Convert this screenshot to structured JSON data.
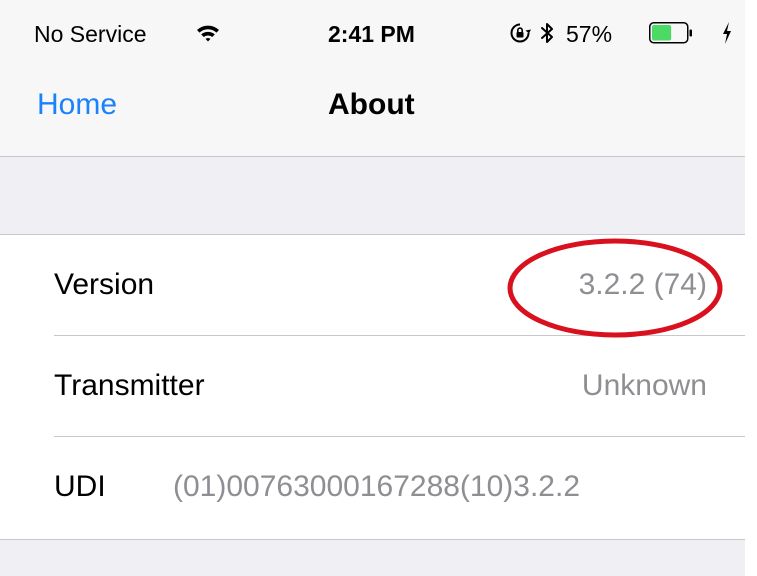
{
  "status_bar": {
    "carrier": "No Service",
    "time": "2:41 PM",
    "battery_percent": "57%",
    "battery_level": 0.57,
    "icons": [
      "wifi-icon",
      "rotation-lock-icon",
      "bluetooth-icon",
      "battery-icon",
      "charging-icon"
    ]
  },
  "nav": {
    "back_label": "Home",
    "title": "About"
  },
  "rows": [
    {
      "label": "Version",
      "value": "3.2.2 (74)"
    },
    {
      "label": "Transmitter",
      "value": "Unknown"
    },
    {
      "label": "UDI",
      "value": "(01)00763000167288(10)3.2.2"
    }
  ],
  "colors": {
    "accent": "#1a82fb",
    "annotation": "#d9101e",
    "battery_fill": "#4cd964",
    "secondary_text": "#8e8e93",
    "grouped_background": "#efeff4"
  }
}
